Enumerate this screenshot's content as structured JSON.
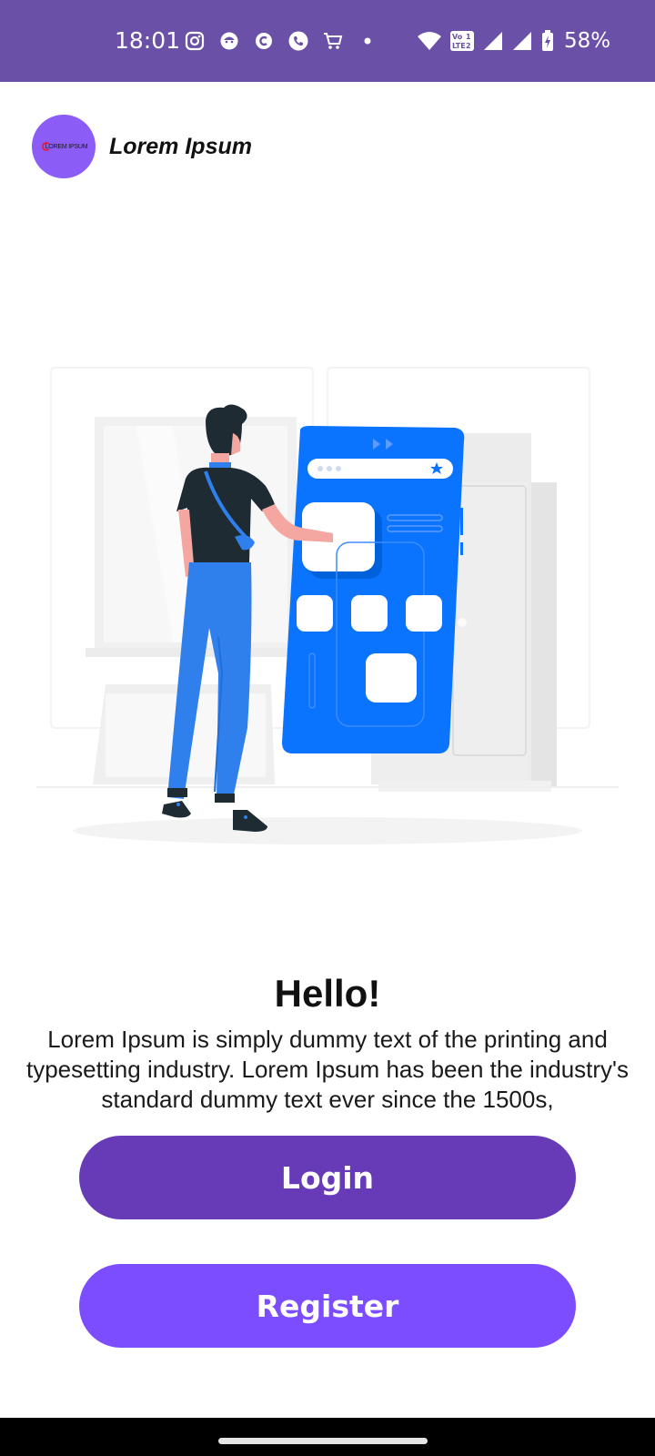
{
  "status_bar": {
    "time": "18:01",
    "battery": "58%",
    "icons": [
      "instagram-icon",
      "app-face-icon",
      "app-c-icon",
      "phone-call-icon",
      "cart-icon",
      "dot-icon",
      "wifi-icon",
      "volte-icon",
      "signal-icon",
      "signal-icon",
      "battery-icon"
    ],
    "volte_label_top": "Vo",
    "volte_label_bottom": "LTE",
    "volte_num_top": "1",
    "volte_num_bottom": "2",
    "background_color": "#6a50a7"
  },
  "header": {
    "logo_text": "LOREM IPSUM",
    "title": "Lorem Ipsum"
  },
  "hero": {
    "illustration": "person-using-giant-phone-illustration"
  },
  "content": {
    "title": "Hello!",
    "description": "Lorem Ipsum is simply dummy text of the printing and typesetting industry. Lorem Ipsum has been the industry's standard dummy text ever since the 1500s,"
  },
  "buttons": {
    "login": "Login",
    "register": "Register"
  },
  "colors": {
    "login": "#673ab7",
    "register": "#7c4dff",
    "logo": "#8b5cf6",
    "phone_blue": "#0a74ff"
  }
}
